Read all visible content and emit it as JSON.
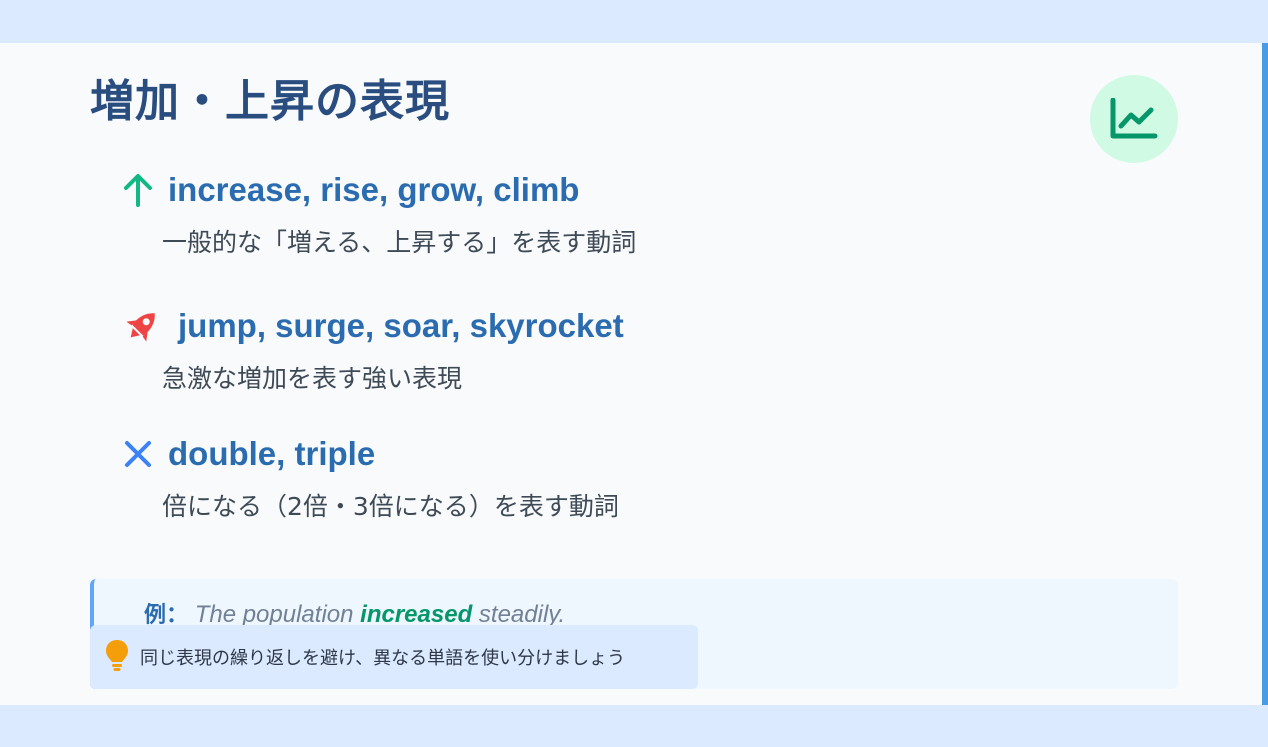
{
  "slide": {
    "title": "増加・上昇の表現",
    "header_icon": "chart-line-icon",
    "items": [
      {
        "icon": "arrow-up-icon",
        "icon_color": "#10b981",
        "term": "increase, rise, grow, climb",
        "description": "一般的な「増える、上昇する」を表す動詞"
      },
      {
        "icon": "rocket-icon",
        "icon_color": "#ef4444",
        "term": "jump, surge, soar, skyrocket",
        "description": "急激な増加を表す強い表現"
      },
      {
        "icon": "times-icon",
        "icon_color": "#3b82f6",
        "term": "double, triple",
        "description": "倍になる（2倍・3倍になる）を表す動詞"
      }
    ],
    "example": {
      "label": "例：",
      "before": "The population ",
      "highlight": "increased",
      "after": " steadily."
    },
    "tip": {
      "icon": "lightbulb-icon",
      "text": "同じ表現の繰り返しを避け、異なる単語を使い分けましょう"
    }
  },
  "colors": {
    "accent": "#2b6cb0",
    "title": "#2a4d80",
    "highlight": "#059669",
    "badge_bg": "#d1fae5",
    "badge_fg": "#059669",
    "tip_icon": "#f59e0b"
  }
}
